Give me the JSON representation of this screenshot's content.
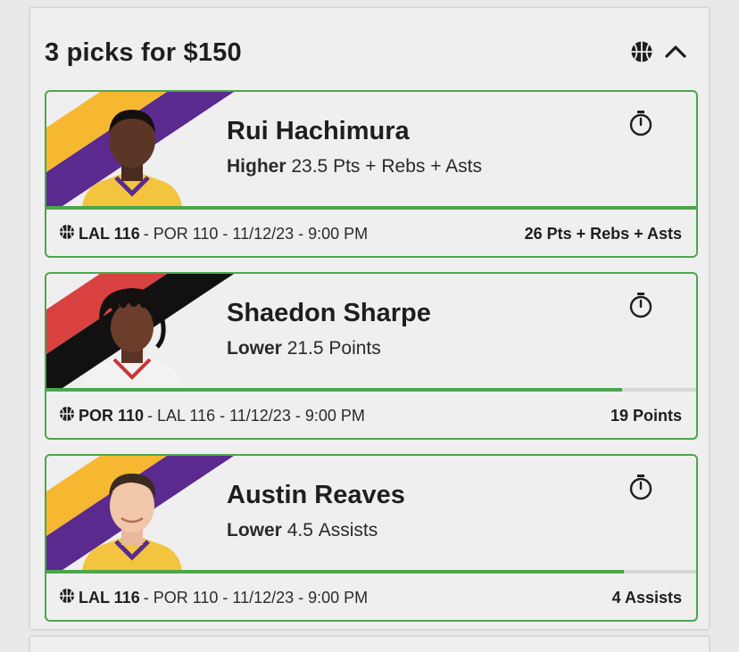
{
  "header": {
    "title": "3 picks for $150",
    "sport_icon": "basketball-icon",
    "collapse_icon": "chevron-up-icon"
  },
  "colors": {
    "accent_green": "#4ca64c",
    "lakers_gold": "#f5b830",
    "lakers_purple": "#5a2a8f",
    "blazers_red": "#d94040",
    "blazers_black": "#111111"
  },
  "picks": [
    {
      "player": "Rui Hachimura",
      "direction": "Higher",
      "line": "23.5",
      "stat": "Pts + Rebs + Asts",
      "team": "LAL 116",
      "opponent": "- POR 110 - 11/12/23 - 9:00 PM",
      "result": "26 Pts + Rebs + Asts",
      "progress": 1.0,
      "timer_icon": "stopwatch-icon"
    },
    {
      "player": "Shaedon Sharpe",
      "direction": "Lower",
      "line": "21.5",
      "stat": "Points",
      "team": "POR 110",
      "opponent": "- LAL 116 - 11/12/23 - 9:00 PM",
      "result": "19 Points",
      "progress": 0.886,
      "timer_icon": "stopwatch-icon"
    },
    {
      "player": "Austin Reaves",
      "direction": "Lower",
      "line": "4.5",
      "stat": "Assists",
      "team": "LAL 116",
      "opponent": "- POR 110 - 11/12/23 - 9:00 PM",
      "result": "4 Assists",
      "progress": 0.889,
      "timer_icon": "stopwatch-icon"
    }
  ]
}
